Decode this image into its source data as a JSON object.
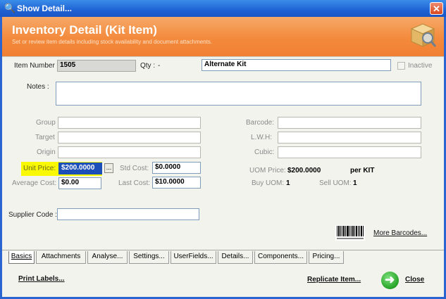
{
  "window": {
    "title": "Show Detail..."
  },
  "header": {
    "title": "Inventory Detail (Kit Item)",
    "subtitle": "Set or review item details including stock availability and document attachments."
  },
  "form": {
    "item_number_label": "Item Number",
    "item_number": "1505",
    "qty_label": "Qty :",
    "qty_value": "-",
    "description": "Alternate Kit",
    "inactive_label": "Inactive",
    "notes_label": "Notes :",
    "notes_value": "",
    "group_label": "Group",
    "target_label": "Target",
    "origin_label": "Origin",
    "barcode_label": "Barcode:",
    "lwh_label": "L.W.H:",
    "cubic_label": "Cubic:",
    "unit_price_label": "Unit Price:",
    "unit_price": "$200.0000",
    "std_cost_label": "Std Cost:",
    "std_cost": "$0.0000",
    "average_cost_label": "Average Cost:",
    "average_cost": "$0.00",
    "last_cost_label": "Last Cost:",
    "last_cost": "$10.0000",
    "uom_price_label": "UOM Price:",
    "uom_price": "$200.0000",
    "uom_per": "per KIT",
    "buy_uom_label": "Buy UOM:",
    "buy_uom": "1",
    "sell_uom_label": "Sell UOM:",
    "sell_uom": "1",
    "supplier_code_label": "Supplier Code :",
    "more_barcodes": "More Barcodes...",
    "ellipsis_button": "..."
  },
  "tabs": [
    {
      "label": "Basics",
      "active": true
    },
    {
      "label": "Attachments",
      "active": false
    },
    {
      "label": "Analyse...",
      "active": false
    },
    {
      "label": "Settings...",
      "active": false
    },
    {
      "label": "UserFields...",
      "active": false
    },
    {
      "label": "Details...",
      "active": false
    },
    {
      "label": "Components...",
      "active": false
    },
    {
      "label": "Pricing...",
      "active": false
    }
  ],
  "footer": {
    "print_labels": "Print Labels...",
    "replicate_item": "Replicate Item...",
    "close": "Close"
  },
  "colors": {
    "titlebar": "#1f62d4",
    "banner": "#f38a3c",
    "highlight": "#f9f900",
    "close_green": "#26a326"
  }
}
